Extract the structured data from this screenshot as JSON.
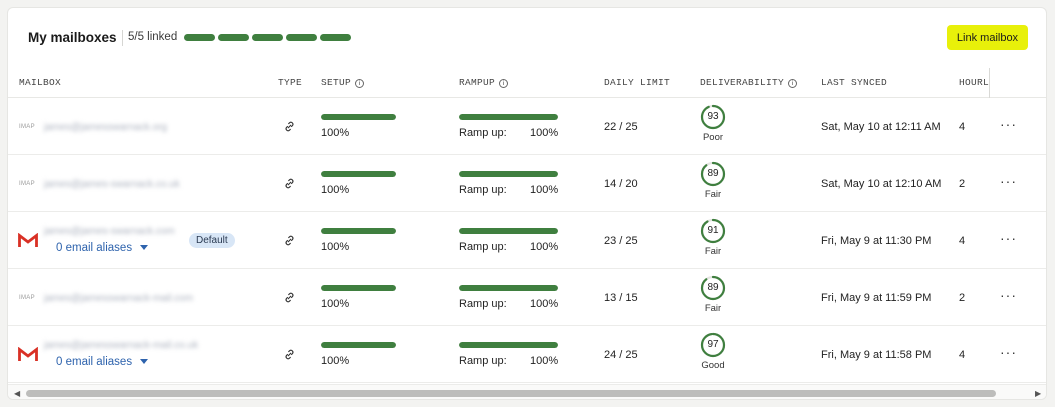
{
  "header": {
    "title": "My mailboxes",
    "linked_text": "5/5 linked",
    "linked_segments": 5,
    "link_button": "Link mailbox"
  },
  "columns": {
    "mailbox": "MAILBOX",
    "type": "TYPE",
    "setup": "SETUP",
    "rampup": "RAMPUP",
    "daily_limit": "DAILY LIMIT",
    "deliverability": "DELIVERABILITY",
    "last_synced": "LAST SYNCED",
    "hourly": "HOURL"
  },
  "colors": {
    "accent_button": "#e8f00a",
    "progress": "#3f7f3f",
    "link_text": "#2e63ad",
    "gmail_red": "#d93025"
  },
  "rows": [
    {
      "provider": "imap",
      "provider_label": "IMAP",
      "email": "james@jamesswarnack.org",
      "aliases": "",
      "badge": "",
      "type_icon": "link-icon",
      "setup": "100%",
      "setup_pct": 100,
      "rampup_label": "Ramp up:",
      "rampup": "100%",
      "rampup_pct": 100,
      "daily_limit": "22 / 25",
      "score": "93",
      "score_label": "Poor",
      "last_synced": "Sat, May 10 at 12:11 AM",
      "hourly": "4"
    },
    {
      "provider": "imap",
      "provider_label": "IMAP",
      "email": "james@james-swarnack.co.uk",
      "aliases": "",
      "badge": "",
      "type_icon": "link-icon",
      "setup": "100%",
      "setup_pct": 100,
      "rampup_label": "Ramp up:",
      "rampup": "100%",
      "rampup_pct": 100,
      "daily_limit": "14 / 20",
      "score": "89",
      "score_label": "Fair",
      "last_synced": "Sat, May 10 at 12:10 AM",
      "hourly": "2"
    },
    {
      "provider": "gmail",
      "provider_label": "",
      "email": "james@james-swarnack.com",
      "aliases": "0 email aliases",
      "badge": "Default",
      "type_icon": "link-icon",
      "setup": "100%",
      "setup_pct": 100,
      "rampup_label": "Ramp up:",
      "rampup": "100%",
      "rampup_pct": 100,
      "daily_limit": "23 / 25",
      "score": "91",
      "score_label": "Fair",
      "last_synced": "Fri, May 9 at 11:30 PM",
      "hourly": "4"
    },
    {
      "provider": "imap",
      "provider_label": "IMAP",
      "email": "james@jamesswarnack-mail.com",
      "aliases": "",
      "badge": "",
      "type_icon": "link-icon",
      "setup": "100%",
      "setup_pct": 100,
      "rampup_label": "Ramp up:",
      "rampup": "100%",
      "rampup_pct": 100,
      "daily_limit": "13 / 15",
      "score": "89",
      "score_label": "Fair",
      "last_synced": "Fri, May 9 at 11:59 PM",
      "hourly": "2"
    },
    {
      "provider": "gmail",
      "provider_label": "",
      "email": "james@jamesswarnack-mail.co.uk",
      "aliases": "0 email aliases",
      "badge": "",
      "type_icon": "link-icon",
      "setup": "100%",
      "setup_pct": 100,
      "rampup_label": "Ramp up:",
      "rampup": "100%",
      "rampup_pct": 100,
      "daily_limit": "24 / 25",
      "score": "97",
      "score_label": "Good",
      "last_synced": "Fri, May 9 at 11:58 PM",
      "hourly": "4"
    }
  ],
  "more_glyph": "···"
}
